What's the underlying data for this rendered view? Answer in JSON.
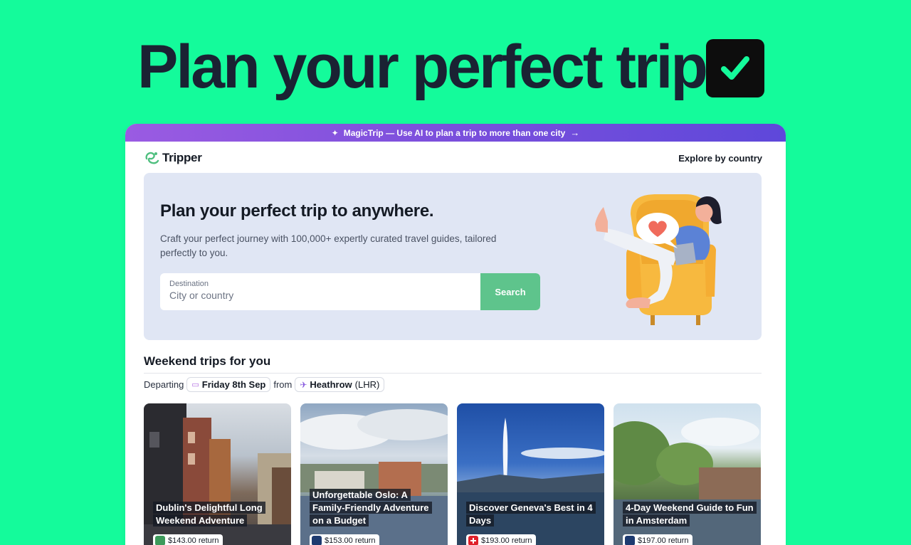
{
  "headline": "Plan your perfect trip",
  "promo": {
    "text": "MagicTrip — Use AI to plan a trip to more than one city"
  },
  "nav": {
    "brand": "Tripper",
    "explore": "Explore by country"
  },
  "hero": {
    "title": "Plan your perfect trip to anywhere.",
    "subtitle": "Craft your perfect journey with 100,000+ expertly curated travel guides, tailored perfectly to you.",
    "destination_label": "Destination",
    "destination_placeholder": "City or country",
    "search_label": "Search"
  },
  "weekend": {
    "title": "Weekend trips for you",
    "departing_label": "Departing",
    "date": "Friday 8th Sep",
    "from_label": "from",
    "airport": "Heathrow",
    "airport_code": "(LHR)"
  },
  "cards": [
    {
      "title": "Dublin's Delightful Long Weekend Adventure",
      "price": "$143.00 return",
      "airline_icon": "aer-lingus-icon"
    },
    {
      "title": "Unforgettable Oslo: A Family-Friendly Adventure on a Budget",
      "price": "$153.00 return",
      "airline_icon": "british-airways-icon"
    },
    {
      "title": "Discover Geneva's Best in 4 Days",
      "price": "$193.00 return",
      "airline_icon": "swiss-icon"
    },
    {
      "title": "4-Day Weekend Guide to Fun in Amsterdam",
      "price": "$197.00 return",
      "airline_icon": "british-airways-icon"
    }
  ],
  "colors": {
    "background": "#14fb9b",
    "accent_purple": "#7a4fdc",
    "search_button": "#5ec48c",
    "hero_card": "#e0e6f4"
  }
}
